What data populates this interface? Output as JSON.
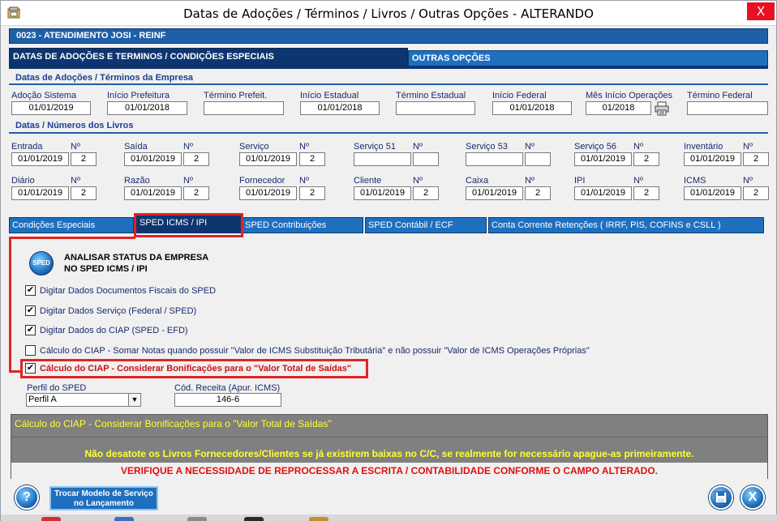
{
  "window": {
    "title": "Datas de Adoções / Términos / Livros / Outras Opções   -   ALTERANDO",
    "close": "X"
  },
  "company": "0023  -  ATENDIMENTO JOSI - REINF",
  "main_tabs": [
    {
      "label": "DATAS DE ADOÇÕES E TERMINOS / CONDIÇÕES ESPECIAIS",
      "active": true
    },
    {
      "label": "OUTRAS OPÇÕES",
      "active": false
    }
  ],
  "adocoes": {
    "section_title": "Datas de Adoções / Términos da Empresa",
    "fields": [
      {
        "label": "Adoção Sistema",
        "value": "01/01/2019"
      },
      {
        "label": "Início Prefeitura",
        "value": "01/01/2018"
      },
      {
        "label": "Término Prefeit.",
        "value": ""
      },
      {
        "label": "Início Estadual",
        "value": "01/01/2018"
      },
      {
        "label": "Término Estadual",
        "value": ""
      },
      {
        "label": "Início Federal",
        "value": "01/01/2018"
      },
      {
        "label": "Mês Início Operações",
        "value": "01/2018"
      },
      {
        "label": "Término Federal",
        "value": ""
      }
    ]
  },
  "livros": {
    "section_title": "Datas / Números dos Livros",
    "num_label": "Nº",
    "row1": [
      {
        "label": "Entrada",
        "date": "01/01/2019",
        "num": "2"
      },
      {
        "label": "Saída",
        "date": "01/01/2019",
        "num": "2"
      },
      {
        "label": "Serviço",
        "date": "01/01/2019",
        "num": "2"
      },
      {
        "label": "Serviço 51",
        "date": "",
        "num": ""
      },
      {
        "label": "Serviço 53",
        "date": "",
        "num": ""
      },
      {
        "label": "Serviço 56",
        "date": "01/01/2019",
        "num": "2"
      },
      {
        "label": "Inventário",
        "date": "01/01/2019",
        "num": "2"
      }
    ],
    "row2": [
      {
        "label": "Diário",
        "date": "01/01/2019",
        "num": "2"
      },
      {
        "label": "Razão",
        "date": "01/01/2019",
        "num": "2"
      },
      {
        "label": "Fornecedor",
        "date": "01/01/2019",
        "num": "2"
      },
      {
        "label": "Cliente",
        "date": "01/01/2019",
        "num": "2"
      },
      {
        "label": "Caixa",
        "date": "01/01/2019",
        "num": "2"
      },
      {
        "label": "IPI",
        "date": "01/01/2019",
        "num": "2"
      },
      {
        "label": "ICMS",
        "date": "01/01/2019",
        "num": "2"
      }
    ]
  },
  "sub_tabs": [
    {
      "label": "Condições Especiais"
    },
    {
      "label": "SPED ICMS / IPI"
    },
    {
      "label": "SPED Contribuições"
    },
    {
      "label": "SPED Contábil / ECF"
    },
    {
      "label": "Conta Corrente Retenções ( IRRF, PIS, COFINS  e  CSLL )"
    }
  ],
  "sped_panel": {
    "icon_text": "SPED",
    "analisar_line1": "ANALISAR STATUS DA EMPRESA",
    "analisar_line2": "NO SPED ICMS / IPI",
    "checks": [
      {
        "label": "Digitar Dados Documentos Fiscais do SPED",
        "checked": true
      },
      {
        "label": "Digitar Dados Serviço (Federal / SPED)",
        "checked": true
      },
      {
        "label": "Digitar Dados do CIAP (SPED - EFD)",
        "checked": true
      },
      {
        "label": "Cálculo do CIAP - Somar Notas quando possuir \"Valor de ICMS Substituição Tributária\" e não possuir \"Valor de ICMS Operações Próprias\"",
        "checked": false
      },
      {
        "label": "Cálculo do CIAP - Considerar Bonificações para o \"Valor Total de Saídas\"",
        "checked": true
      }
    ],
    "perfil_label": "Perfil do SPED",
    "perfil_value": "Perfil A",
    "cod_receita_label": "Cód. Receita (Apur. ICMS)",
    "cod_receita_value": "146-6"
  },
  "status": {
    "hint": "Cálculo do CIAP - Considerar Bonificações para o \"Valor Total de Saídas\"",
    "warning1": "Não desatote os Livros Fornecedores/Clientes se já existirem baixas no C/C, se realmente for necessário apague-as primeiramente.",
    "warning2": "VERIFIQUE A NECESSIDADE DE REPROCESSAR A ESCRITA / CONTABILIDADE CONFORME O CAMPO ALTERADO."
  },
  "footer": {
    "help": "?",
    "troca_line1": "Trocar Modelo de Serviço",
    "troca_line2": "no Lançamento",
    "save": "💾",
    "exit": "X"
  }
}
